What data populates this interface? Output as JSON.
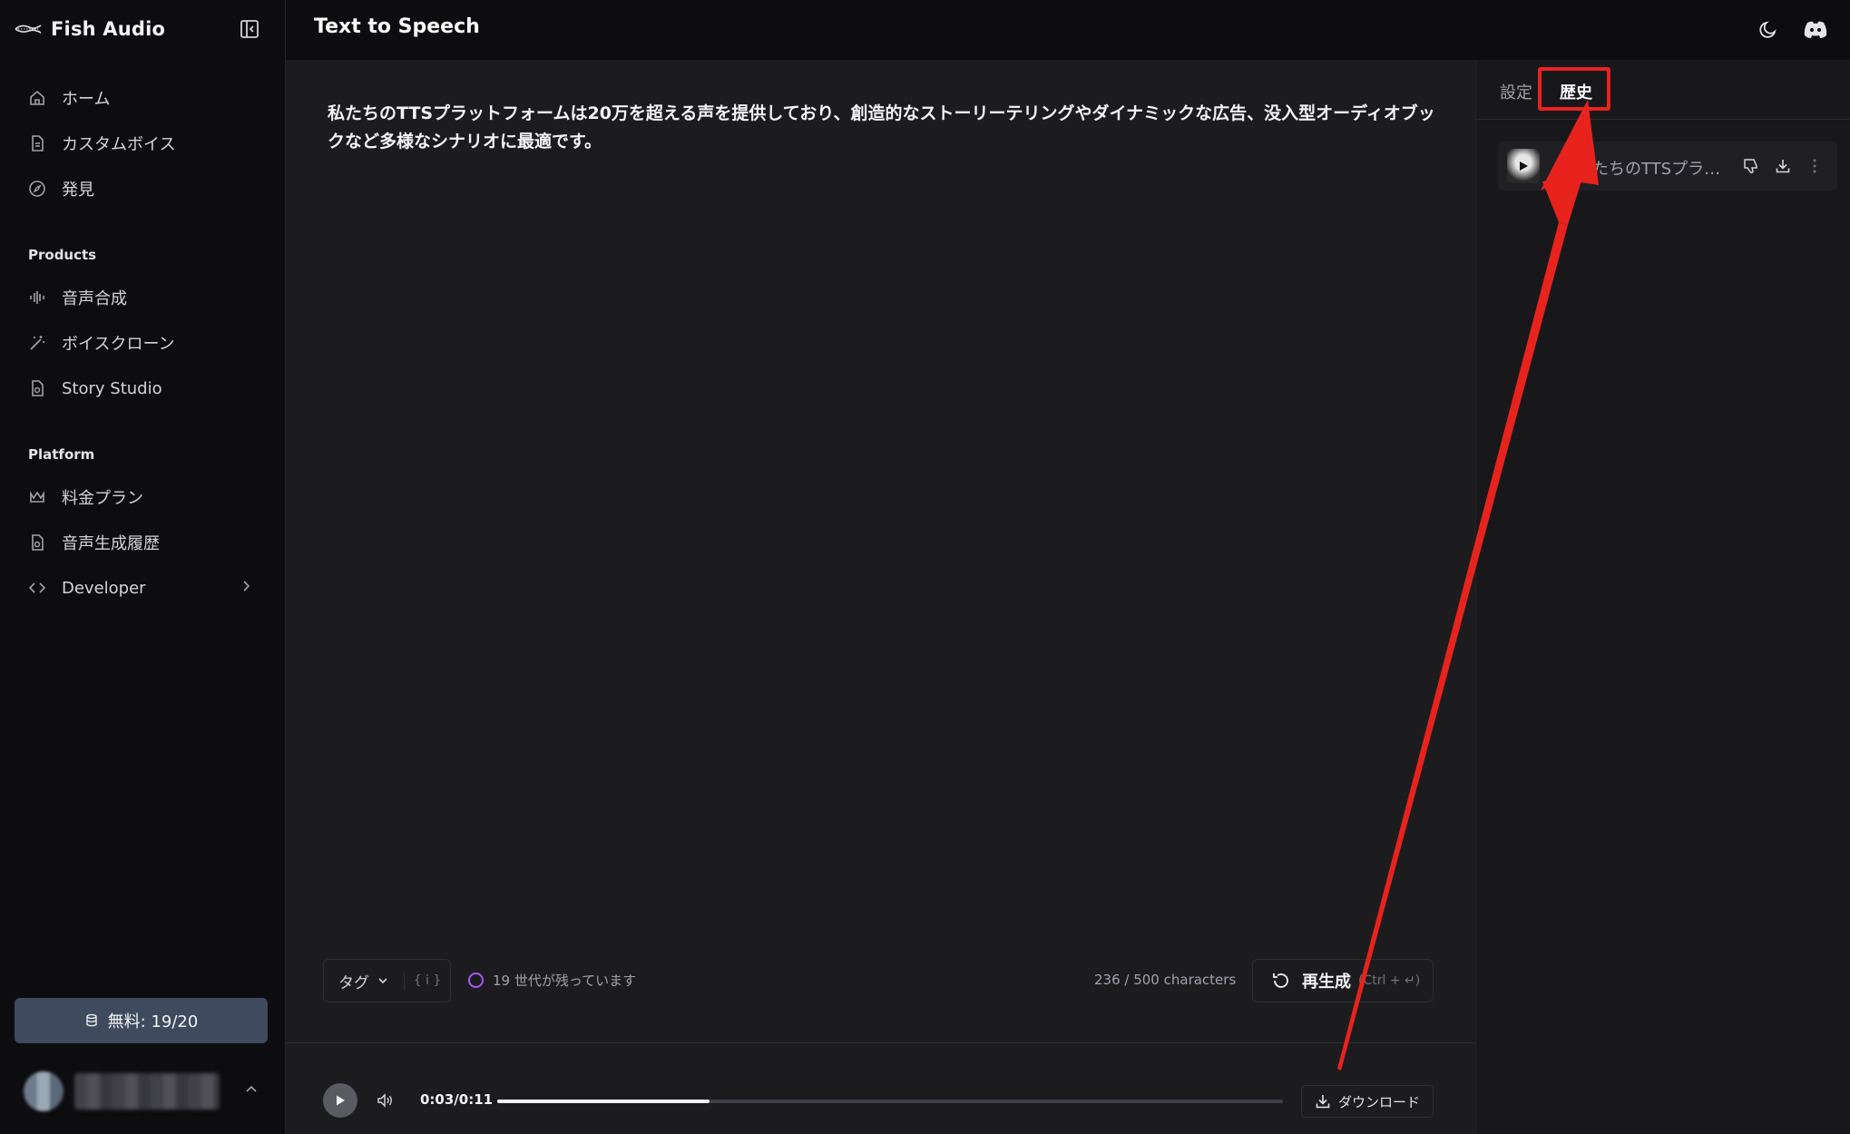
{
  "brand": {
    "name": "Fish Audio"
  },
  "header": {
    "title": "Text to Speech"
  },
  "sidebar": {
    "main_items": [
      {
        "label": "ホーム",
        "icon": "home-icon"
      },
      {
        "label": "カスタムボイス",
        "icon": "document-icon"
      },
      {
        "label": "発見",
        "icon": "compass-icon"
      }
    ],
    "products_label": "Products",
    "product_items": [
      {
        "label": "音声合成",
        "icon": "waveform-icon"
      },
      {
        "label": "ボイスクローン",
        "icon": "magic-wand-icon"
      },
      {
        "label": "Story Studio",
        "icon": "book-icon"
      }
    ],
    "platform_label": "Platform",
    "platform_items": [
      {
        "label": "料金プラン",
        "icon": "crown-icon"
      },
      {
        "label": "音声生成履歴",
        "icon": "history-doc-icon"
      },
      {
        "label": "Developer",
        "icon": "code-icon"
      }
    ],
    "credits_label": "無料: 19/20"
  },
  "editor": {
    "text": "私たちのTTSプラットフォームは20万を超える声を提供しており、創造的なストーリーテリングやダイナミックな広告、没入型オーディオブックなど多様なシナリオに最適です。",
    "tag_label": "タグ",
    "brace_label": "{ i }",
    "generations_left": "19 世代が残っています",
    "char_count": "236 / 500 characters",
    "regenerate_label": "再生成",
    "regenerate_shortcut": "(Ctrl + ↵)"
  },
  "player": {
    "time": "0:03/0:11",
    "progress_fraction": 0.27,
    "download_label": "ダウンロード"
  },
  "right_panel": {
    "tabs": [
      {
        "label": "設定",
        "active": false
      },
      {
        "label": "歴史",
        "active": true
      }
    ],
    "history_items": [
      {
        "text": "私たちのTTSプラット..."
      }
    ]
  },
  "colors": {
    "annotation": "#e8231d",
    "accent_ring": "#a855f7",
    "credits_bg": "#3f4a5e"
  }
}
